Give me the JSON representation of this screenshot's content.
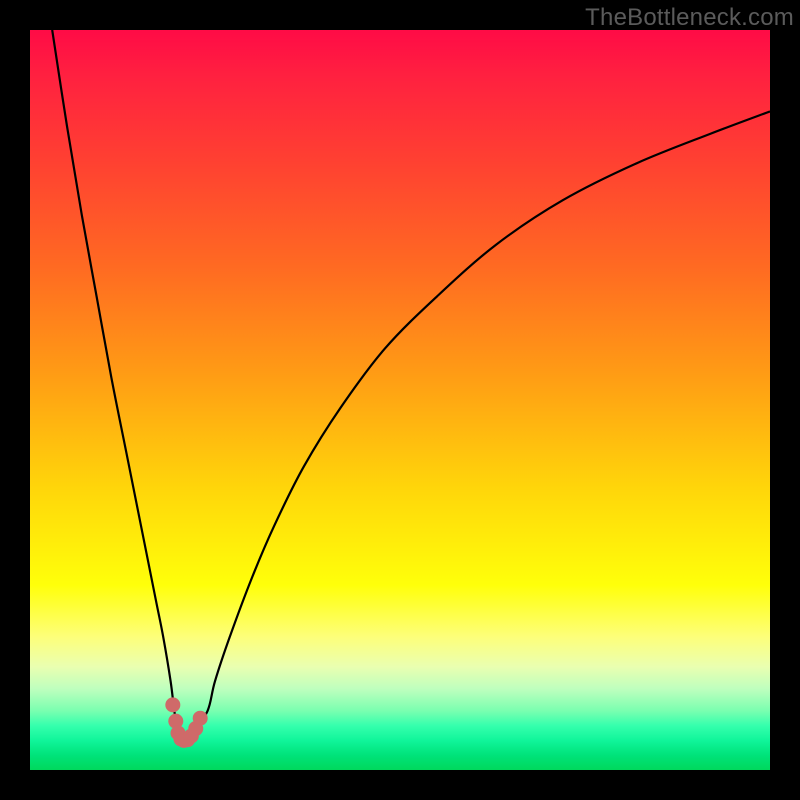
{
  "watermark": "TheBottleneck.com",
  "colors": {
    "frame": "#000000",
    "curve": "#000000",
    "marker": "#cf6a69"
  },
  "chart_data": {
    "type": "line",
    "title": "",
    "xlabel": "",
    "ylabel": "",
    "xlim": [
      0,
      100
    ],
    "ylim": [
      0,
      100
    ],
    "grid": false,
    "series": [
      {
        "name": "bottleneck-curve",
        "x": [
          3,
          5,
          7,
          9,
          11,
          13,
          15,
          17,
          18,
          19,
          19.5,
          20,
          20.5,
          21,
          21.2,
          22,
          24,
          25,
          27,
          30,
          33,
          37,
          42,
          48,
          55,
          63,
          72,
          82,
          92,
          100
        ],
        "y": [
          100,
          87,
          75,
          64,
          53,
          43,
          33,
          23,
          18,
          12,
          8,
          5,
          4,
          4,
          4.2,
          5,
          8,
          12,
          18,
          26,
          33,
          41,
          49,
          57,
          64,
          71,
          77,
          82,
          86,
          89
        ]
      }
    ],
    "markers": {
      "name": "minimum-dots",
      "x": [
        19.3,
        19.7,
        20.0,
        20.4,
        20.8,
        21.3,
        21.8,
        22.4,
        23.0
      ],
      "y": [
        8.8,
        6.6,
        5.0,
        4.2,
        4.0,
        4.1,
        4.6,
        5.6,
        7.0
      ]
    },
    "background_gradient": [
      "#ff0b46",
      "#ffff0a",
      "#00d85c"
    ]
  }
}
